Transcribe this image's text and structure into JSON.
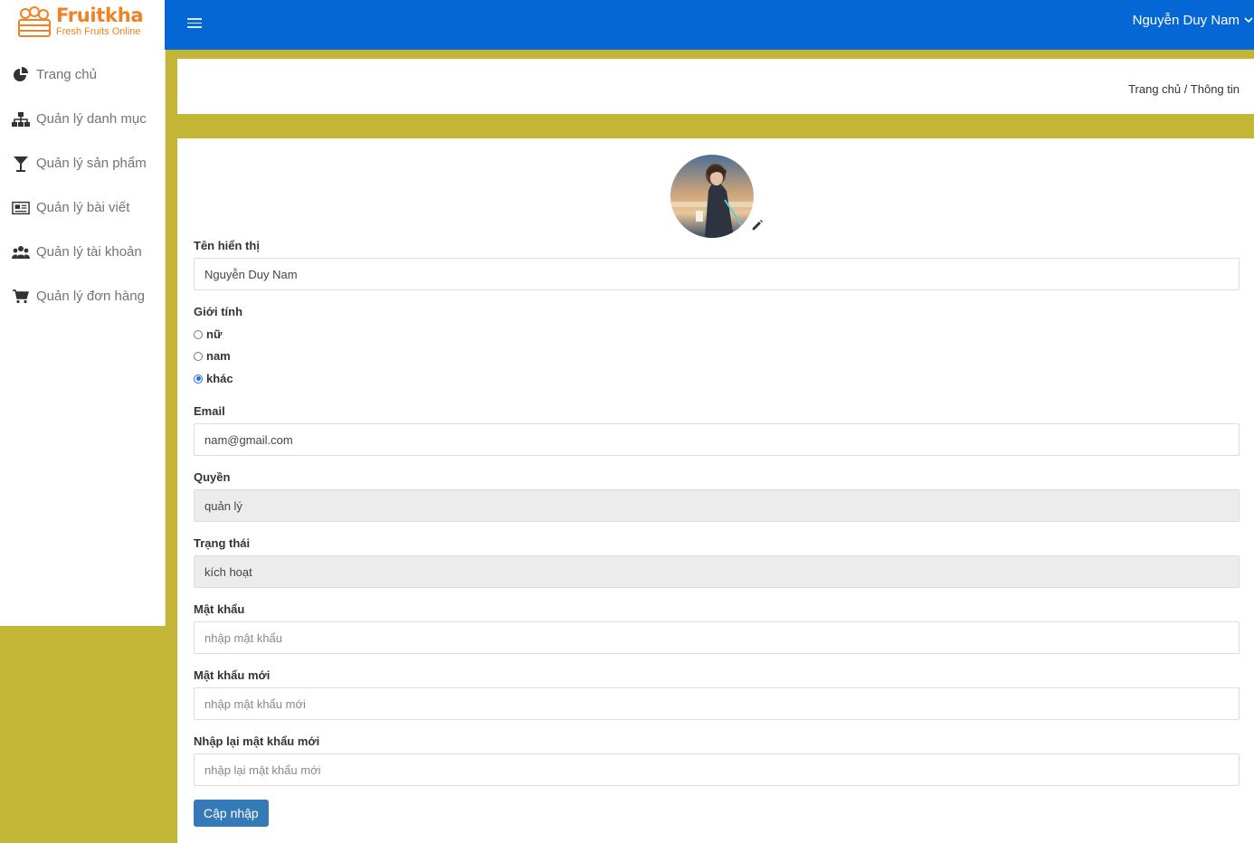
{
  "brand": {
    "name": "Fruitkha",
    "tagline": "Fresh Fruits Online",
    "accent_color": "#f28123"
  },
  "colors": {
    "topbar": "#0567d6",
    "page_background": "#c3b535",
    "primary_button": "#337ab7"
  },
  "sidebar": {
    "items": [
      {
        "label": "Trang chủ",
        "icon": "pie-chart-icon"
      },
      {
        "label": "Quản lý danh mục",
        "icon": "sitemap-icon"
      },
      {
        "label": "Quản lý sản phẩm",
        "icon": "cocktail-glass-icon"
      },
      {
        "label": "Quản lý bài viết",
        "icon": "newspaper-icon"
      },
      {
        "label": "Quản lý tài khoản",
        "icon": "users-icon"
      },
      {
        "label": "Quản lý đơn hàng",
        "icon": "shopping-cart-icon"
      }
    ]
  },
  "topbar": {
    "menu_icon": "hamburger-icon",
    "user_name": "Nguyễn Duy Nam",
    "user_chevron_icon": "chevron-down-icon"
  },
  "breadcrumb": {
    "home": "Trang chủ",
    "separator": "/",
    "current": "Thông tin"
  },
  "profile": {
    "avatar": "avatar-image",
    "edit_icon": "pencil-icon",
    "display_name": {
      "label": "Tên hiển thị",
      "value": "Nguyễn Duy Nam"
    },
    "gender": {
      "label": "Giới tính",
      "options": [
        "nữ",
        "nam",
        "khác"
      ],
      "selected": "khác"
    },
    "email": {
      "label": "Email",
      "value": "nam@gmail.com"
    },
    "role": {
      "label": "Quyền",
      "value": "quản lý"
    },
    "status": {
      "label": "Trạng thái",
      "value": "kích hoạt"
    },
    "password": {
      "label": "Mật khẩu",
      "placeholder": "nhập mật khẩu"
    },
    "new_password": {
      "label": "Mật khẩu mới",
      "placeholder": "nhập mật khẩu mới"
    },
    "confirm_password": {
      "label": "Nhập lại mật khẩu mới",
      "placeholder": "nhập lại mật khẩu mới"
    },
    "submit_label": "Cập nhập"
  }
}
